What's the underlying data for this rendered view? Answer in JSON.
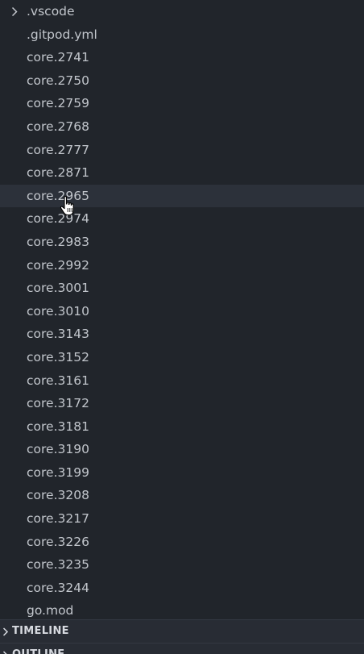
{
  "explorer": {
    "items": [
      {
        "label": ".vscode",
        "kind": "folder",
        "expanded": false
      },
      {
        "label": ".gitpod.yml",
        "kind": "file"
      },
      {
        "label": "core.2741",
        "kind": "file"
      },
      {
        "label": "core.2750",
        "kind": "file"
      },
      {
        "label": "core.2759",
        "kind": "file"
      },
      {
        "label": "core.2768",
        "kind": "file"
      },
      {
        "label": "core.2777",
        "kind": "file"
      },
      {
        "label": "core.2871",
        "kind": "file"
      },
      {
        "label": "core.2965",
        "kind": "file",
        "hovered": true
      },
      {
        "label": "core.2974",
        "kind": "file"
      },
      {
        "label": "core.2983",
        "kind": "file"
      },
      {
        "label": "core.2992",
        "kind": "file"
      },
      {
        "label": "core.3001",
        "kind": "file"
      },
      {
        "label": "core.3010",
        "kind": "file"
      },
      {
        "label": "core.3143",
        "kind": "file"
      },
      {
        "label": "core.3152",
        "kind": "file"
      },
      {
        "label": "core.3161",
        "kind": "file"
      },
      {
        "label": "core.3172",
        "kind": "file"
      },
      {
        "label": "core.3181",
        "kind": "file"
      },
      {
        "label": "core.3190",
        "kind": "file"
      },
      {
        "label": "core.3199",
        "kind": "file"
      },
      {
        "label": "core.3208",
        "kind": "file"
      },
      {
        "label": "core.3217",
        "kind": "file"
      },
      {
        "label": "core.3226",
        "kind": "file"
      },
      {
        "label": "core.3235",
        "kind": "file"
      },
      {
        "label": "core.3244",
        "kind": "file"
      },
      {
        "label": "go.mod",
        "kind": "file"
      }
    ]
  },
  "sections": {
    "timeline": "TIMELINE",
    "outline": "OUTLINE"
  },
  "icons": {
    "folder_chevron": "chevron-right-icon",
    "section_chevron": "chevron-right-icon",
    "cursor": "hand-pointer-icon"
  },
  "colors": {
    "background": "#21252b",
    "hover_row": "#2c313a",
    "text": "#c2c6cc",
    "section_background": "#282c34"
  }
}
